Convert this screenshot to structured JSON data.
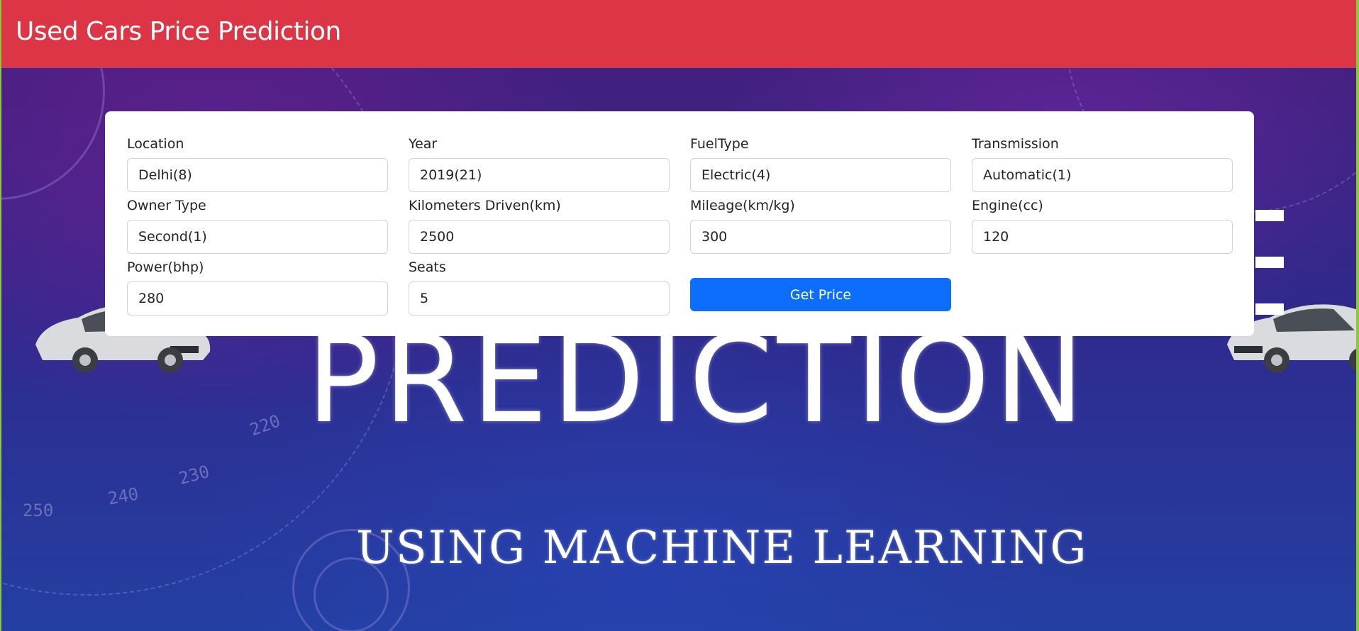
{
  "app": {
    "title": "Used Cars Price Prediction"
  },
  "hero": {
    "headline": "PREDICTION",
    "subheadline": "USING MACHINE LEARNING"
  },
  "form": {
    "fields": [
      {
        "label": "Location",
        "value": "Delhi(8)"
      },
      {
        "label": "Year",
        "value": "2019(21)"
      },
      {
        "label": "FuelType",
        "value": "Electric(4)"
      },
      {
        "label": "Transmission",
        "value": "Automatic(1)"
      },
      {
        "label": "Owner Type",
        "value": "Second(1)"
      },
      {
        "label": "Kilometers Driven(km)",
        "value": "2500"
      },
      {
        "label": "Mileage(km/kg)",
        "value": "300"
      },
      {
        "label": "Engine(cc)",
        "value": "120"
      },
      {
        "label": "Power(bhp)",
        "value": "280"
      },
      {
        "label": "Seats",
        "value": "5"
      }
    ],
    "submit_label": "Get Price"
  },
  "colors": {
    "navbar": "#dc3545",
    "button": "#0d6efd",
    "frame": "#8dc63f"
  }
}
